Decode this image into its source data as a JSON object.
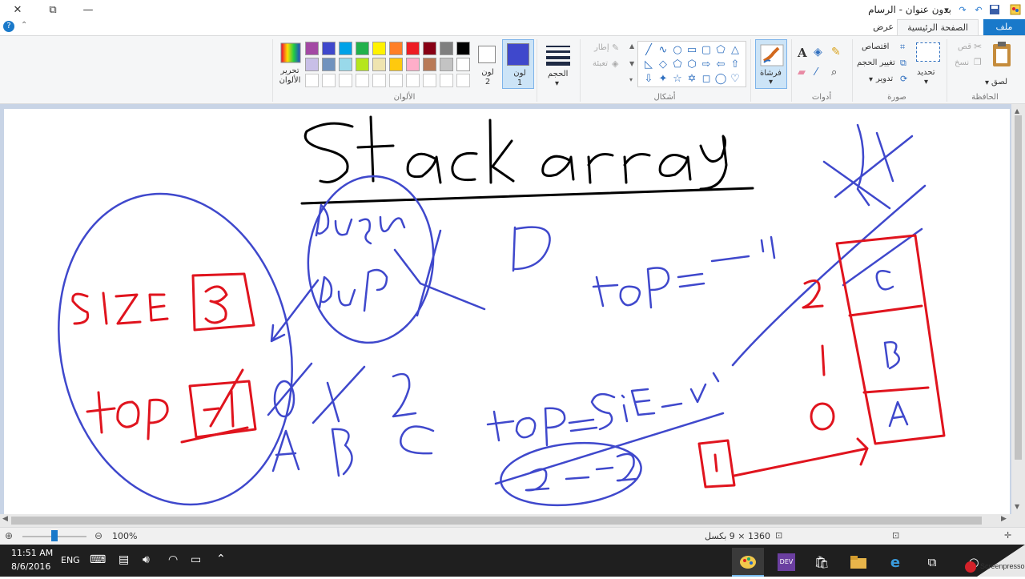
{
  "window": {
    "title": "بدون عنوان - الرسام",
    "close_glyph": "✕",
    "restore_glyph": "⧉",
    "minimize_glyph": "—"
  },
  "tabs": {
    "file": "ملف",
    "home": "الصفحة الرئيسية",
    "view": "عرض"
  },
  "clipboard": {
    "paste": "لصق",
    "cut": "قص",
    "copy": "نسخ",
    "group": "الحافظة"
  },
  "image": {
    "select": "تحديد",
    "crop": "اقتصاص",
    "resize": "تغيير الحجم",
    "rotate": "تدوير",
    "group": "صورة"
  },
  "tools": {
    "group": "أدوات"
  },
  "brushes": {
    "label": "فرشاة"
  },
  "shapes": {
    "outline": "إطار",
    "fill": "تعبئة",
    "group": "أشكال"
  },
  "size": {
    "label": "الحجم"
  },
  "colors": {
    "color1": "لون 1",
    "color2": "لون 2",
    "edit": "تحرير الألوان",
    "group": "الألوان",
    "color1_value": "#3f48cc",
    "color2_value": "#ffffff",
    "palette_row1": [
      "#000000",
      "#7f7f7f",
      "#880015",
      "#ed1c24",
      "#ff7f27",
      "#fff200",
      "#22b14c",
      "#00a2e8",
      "#3f48cc",
      "#a349a4"
    ],
    "palette_row2": [
      "#ffffff",
      "#c3c3c3",
      "#b97a57",
      "#ffaec9",
      "#ffc90e",
      "#efe4b0",
      "#b5e61d",
      "#99d9ea",
      "#7092be",
      "#c8bfe7"
    ]
  },
  "status": {
    "zoom": "100%",
    "dimensions": "1360 × 9 بكسل"
  },
  "taskbar": {
    "time": "11:51 AM",
    "date": "8/6/2016",
    "lang": "ENG"
  },
  "drawing": {
    "ink_blue": "#3f48cc",
    "ink_red": "#e0141e",
    "ink_black": "#000000"
  }
}
